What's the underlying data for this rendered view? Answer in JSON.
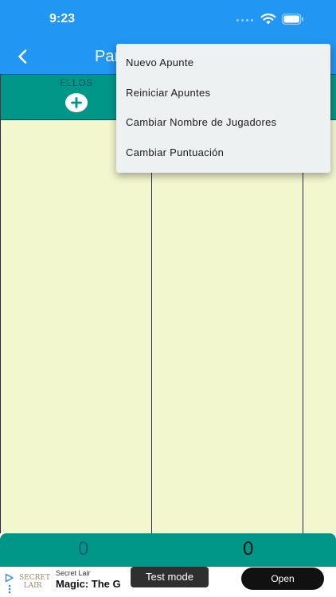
{
  "status_bar": {
    "time": "9:23"
  },
  "app_bar": {
    "title": "Par"
  },
  "players": [
    {
      "name": "ELLOS"
    }
  ],
  "totals": {
    "team1": "0",
    "team2": "0"
  },
  "menu": {
    "items": [
      {
        "label": "Nuevo Apunte"
      },
      {
        "label": "Reiniciar Apuntes"
      },
      {
        "label": "Cambiar Nombre de Jugadores"
      },
      {
        "label": "Cambiar Puntuación"
      }
    ]
  },
  "ad": {
    "sponsor": "Secret Lair",
    "headline": "Magic: The G",
    "test_mode_label": "Test mode",
    "open_label": "Open",
    "logo_top": "SECRET",
    "logo_bottom": "LAIR"
  },
  "colors": {
    "app_bar": "#2196f3",
    "header_teal": "#009688",
    "sheet_background": "#f3f7cd",
    "menu_background": "#edf1f2"
  },
  "icons": {
    "back": "chevron-left-icon",
    "add": "plus-circle-icon",
    "wifi": "wifi-icon",
    "battery": "battery-icon",
    "ad_choices": "ad-choices-icon"
  }
}
